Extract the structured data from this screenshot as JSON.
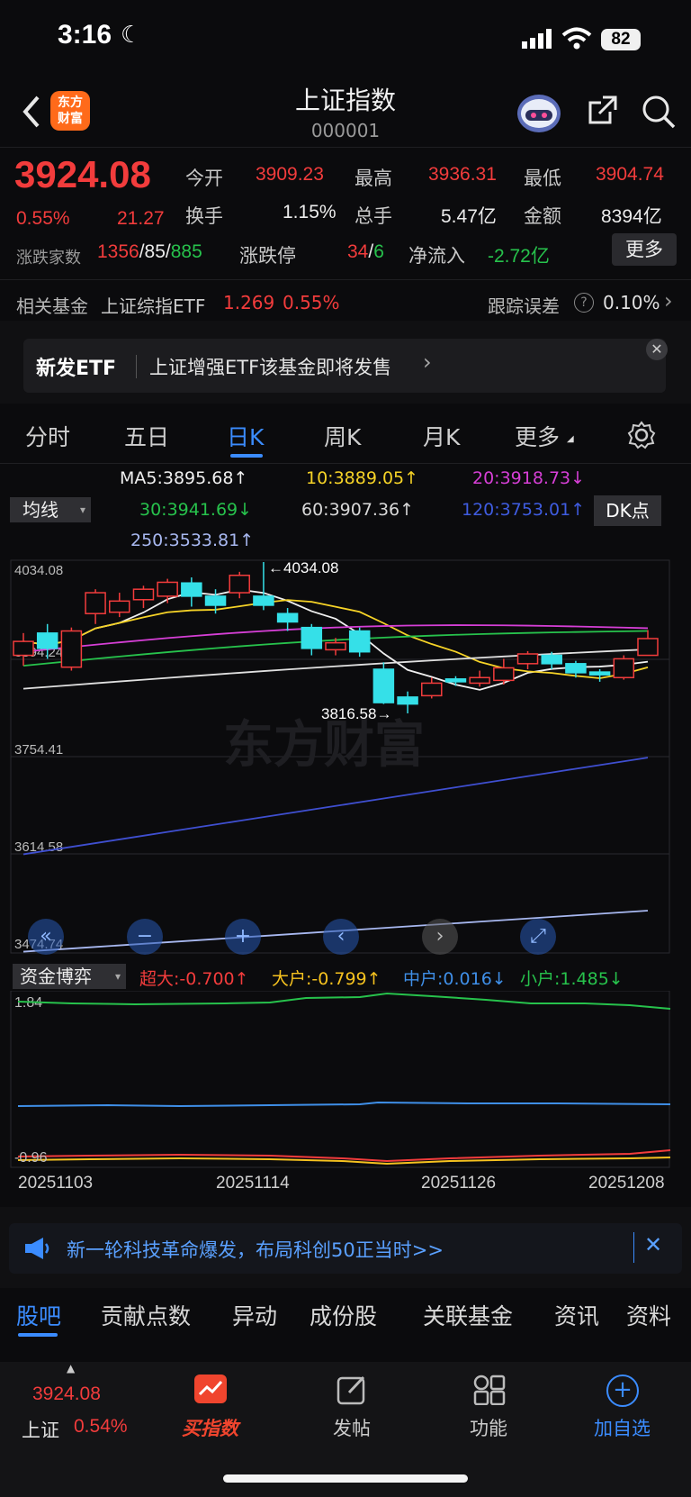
{
  "status_bar": {
    "time": "3:16",
    "battery": "82"
  },
  "header": {
    "title": "上证指数",
    "code": "000001",
    "logo_line1": "东方",
    "logo_line2": "财富"
  },
  "quote": {
    "price": "3924.08",
    "pct": "0.55%",
    "change": "21.27",
    "open_label": "今开",
    "open": "3909.23",
    "high_label": "最高",
    "high": "3936.31",
    "low_label": "最低",
    "low": "3904.74",
    "turnover_label": "换手",
    "turnover": "1.15%",
    "volume_label": "总手",
    "volume": "5.47亿",
    "amount_label": "金额",
    "amount": "8394亿",
    "breadth_label": "涨跌家数",
    "up": "1356",
    "flat": "/85/",
    "down": "885",
    "limit_label": "涨跌停",
    "limit_up": "34",
    "limit_sep": "/",
    "limit_down": "6",
    "netflow_label": "净流入",
    "netflow": "-2.72亿",
    "more": "更多"
  },
  "related_fund": {
    "label": "相关基金",
    "name": "上证综指ETF",
    "price": "1.269",
    "pct": "0.55%",
    "tracking_label": "跟踪误差",
    "tracking": "0.10%"
  },
  "etf_banner": {
    "tag": "新发ETF",
    "text": "上证增强ETF该基金即将发售"
  },
  "chart_tabs": [
    "分时",
    "五日",
    "日K",
    "周K",
    "月K",
    "更多"
  ],
  "ma": {
    "button": "均线",
    "dk": "DK点",
    "ma5": "MA5:3895.68↑",
    "ma10": "10:3889.05↑",
    "ma20": "20:3918.73↓",
    "ma30": "30:3941.69↓",
    "ma60": "60:3907.36↑",
    "ma120": "120:3753.01↑",
    "ma250": "250:3533.81↑"
  },
  "chart_data": {
    "type": "candlestick",
    "price_axis_labels": [
      "4034.08",
      "3894.24",
      "3754.41",
      "3614.58",
      "3474.74"
    ],
    "annotations": {
      "high": "←4034.08",
      "low": "3816.58→"
    },
    "watermark": "东方财富",
    "candles": [
      {
        "o": 3900,
        "c": 3920,
        "h": 3932,
        "l": 3885
      },
      {
        "o": 3932,
        "c": 3910,
        "h": 3945,
        "l": 3895
      },
      {
        "o": 3883,
        "c": 3935,
        "h": 3940,
        "l": 3878
      },
      {
        "o": 3960,
        "c": 3990,
        "h": 3995,
        "l": 3945
      },
      {
        "o": 3962,
        "c": 3978,
        "h": 3990,
        "l": 3955
      },
      {
        "o": 3980,
        "c": 3995,
        "h": 4000,
        "l": 3968
      },
      {
        "o": 3985,
        "c": 4005,
        "h": 4010,
        "l": 3975
      },
      {
        "o": 4004,
        "c": 3985,
        "h": 4012,
        "l": 3970
      },
      {
        "o": 3985,
        "c": 3972,
        "h": 3995,
        "l": 3960
      },
      {
        "o": 3990,
        "c": 4015,
        "h": 4020,
        "l": 3982
      },
      {
        "o": 3985,
        "c": 3972,
        "h": 4034.08,
        "l": 3965
      },
      {
        "o": 3960,
        "c": 3948,
        "h": 3968,
        "l": 3935
      },
      {
        "o": 3940,
        "c": 3910,
        "h": 3945,
        "l": 3900
      },
      {
        "o": 3908,
        "c": 3918,
        "h": 3925,
        "l": 3900
      },
      {
        "o": 3935,
        "c": 3905,
        "h": 3940,
        "l": 3898
      },
      {
        "o": 3880,
        "c": 3832,
        "h": 3890,
        "l": 3830
      },
      {
        "o": 3840,
        "c": 3830,
        "h": 3848,
        "l": 3816.58
      },
      {
        "o": 3842,
        "c": 3860,
        "h": 3868,
        "l": 3838
      },
      {
        "o": 3866,
        "c": 3862,
        "h": 3870,
        "l": 3856
      },
      {
        "o": 3860,
        "c": 3868,
        "h": 3878,
        "l": 3855
      },
      {
        "o": 3864,
        "c": 3882,
        "h": 3895,
        "l": 3858
      },
      {
        "o": 3888,
        "c": 3902,
        "h": 3906,
        "l": 3880
      },
      {
        "o": 3900,
        "c": 3888,
        "h": 3905,
        "l": 3880
      },
      {
        "o": 3888,
        "c": 3875,
        "h": 3892,
        "l": 3868
      },
      {
        "o": 3876,
        "c": 3872,
        "h": 3880,
        "l": 3862
      },
      {
        "o": 3868,
        "c": 3895,
        "h": 3900,
        "l": 3865
      },
      {
        "o": 3900,
        "c": 3924.08,
        "h": 3936.31,
        "l": 3904.74
      }
    ],
    "x_labels": [
      "20251103",
      "20251114",
      "20251126",
      "20251208"
    ]
  },
  "fund_flow": {
    "button": "资金博弈",
    "super": "超大:-0.700↑",
    "big": "大户:-0.799↑",
    "mid": "中户:0.016↓",
    "small": "小户:1.485↓",
    "axis_top": "1.84",
    "axis_bottom": "-0.96"
  },
  "promo": {
    "text": "新一轮科技革命爆发，布局科创50正当时>>"
  },
  "bottom_tabs": [
    "股吧",
    "贡献点数",
    "异动",
    "成份股",
    "关联基金",
    "资讯",
    "资料"
  ],
  "bottom_bar": {
    "price": "3924.08",
    "name": "上证",
    "pct": "0.54%",
    "buy": "买指数",
    "post": "发帖",
    "func": "功能",
    "add": "加自选"
  },
  "colors": {
    "up": "#f23c3c",
    "down": "#27c24c",
    "accent": "#3b8cff",
    "cyan": "#35e0e8"
  }
}
